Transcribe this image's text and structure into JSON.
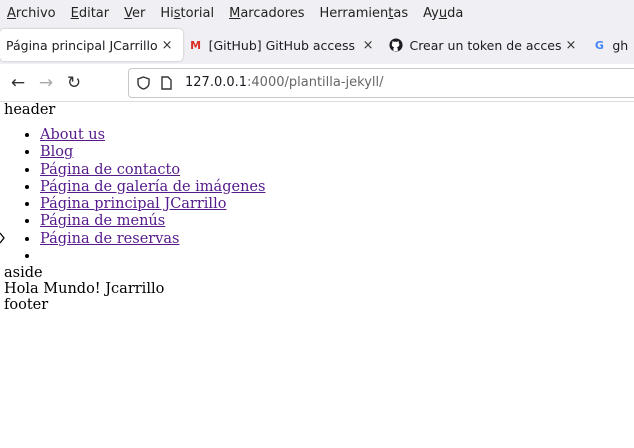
{
  "menubar": {
    "items": [
      {
        "first": "A",
        "rest": "rchivo"
      },
      {
        "first": "E",
        "rest": "ditar"
      },
      {
        "first": "V",
        "rest": "er"
      },
      {
        "pre": "Hi",
        "first": "s",
        "rest": "torial"
      },
      {
        "first": "M",
        "rest": "arcadores"
      },
      {
        "pre": "Herramien",
        "first": "t",
        "rest": "as"
      },
      {
        "pre": "Ay",
        "first": "u",
        "rest": "da"
      }
    ]
  },
  "tabs": [
    {
      "label": "Página principal JCarrillo",
      "icon": "",
      "close": "×",
      "active": true
    },
    {
      "label": "[GitHub] GitHub access t",
      "icon": "gmail-icon",
      "close": "×",
      "active": false
    },
    {
      "label": "Crear un token de acceso",
      "icon": "github-icon",
      "close": "×",
      "active": false
    },
    {
      "label": "gh",
      "icon": "google-icon",
      "close": "",
      "active": false
    }
  ],
  "nav": {
    "url_host": "127.0.0.1",
    "url_path": ":4000/plantilla-jekyll/"
  },
  "page": {
    "header": "header",
    "links": [
      "About us",
      "Blog",
      "Página de contacto",
      "Página de galería de imágenes",
      "Página principal JCarrillo",
      "Página de menús",
      "Página de reservas",
      ""
    ],
    "aside": "aside",
    "main": "Hola Mundo! Jcarrillo",
    "footer": "footer"
  },
  "colors": {
    "link": "#551a8b",
    "chrome": "#f0f0f4"
  }
}
